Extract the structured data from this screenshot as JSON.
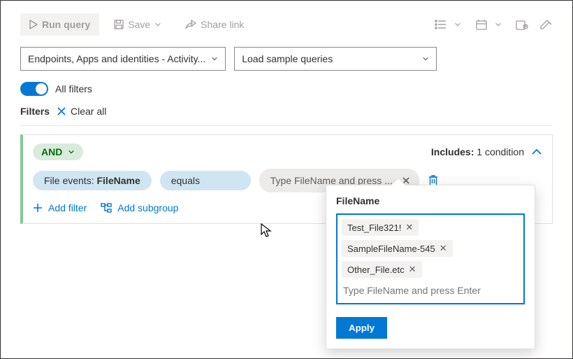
{
  "toolbar": {
    "run_label": "Run query",
    "save_label": "Save",
    "share_label": "Share link"
  },
  "selects": {
    "scope": "Endpoints, Apps and identities - Activity...",
    "samples": "Load sample queries"
  },
  "toggle": {
    "label": "All filters",
    "on": true
  },
  "filters_header": {
    "label": "Filters",
    "clear": "Clear all"
  },
  "card": {
    "logic": "AND",
    "includes_prefix": "Includes:",
    "includes_count": "1 condition",
    "field_label_prefix": "File events: ",
    "field_label_bold": "FileName",
    "operator": "equals",
    "value_placeholder": "Type FileName and press ...",
    "add_filter": "Add filter",
    "add_subgroup": "Add subgroup"
  },
  "popover": {
    "title": "FileName",
    "tokens": [
      "Test_File321!",
      "SampleFileName-545",
      "Other_File.etc"
    ],
    "input_placeholder": "Type FileName and press Enter",
    "apply": "Apply"
  },
  "colors": {
    "primary": "#0078d4",
    "green_bg": "#d9ecdb",
    "green_border": "#85c898"
  }
}
